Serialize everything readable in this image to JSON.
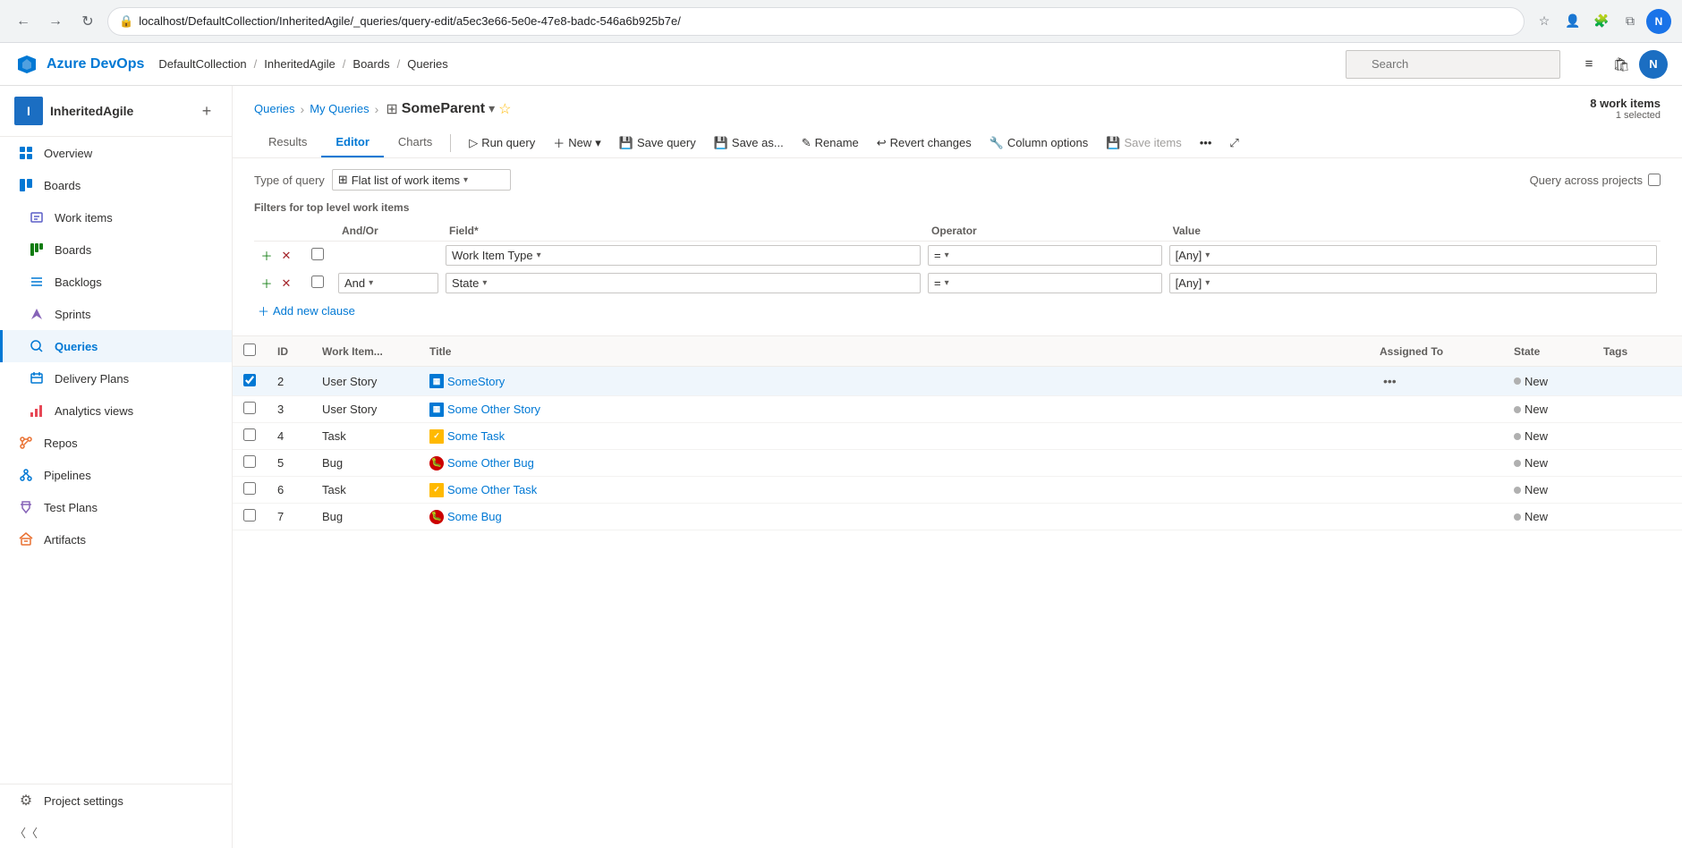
{
  "browser": {
    "address": "localhost/DefaultCollection/InheritedAgile/_queries/query-edit/a5ec3e66-5e0e-47e8-badc-546a6b925b7e/",
    "user_initial": "N"
  },
  "topnav": {
    "logo_text": "Azure DevOps",
    "breadcrumb": [
      {
        "label": "DefaultCollection"
      },
      {
        "label": "InheritedAgile"
      },
      {
        "label": "Boards"
      },
      {
        "label": "Queries"
      }
    ],
    "search_placeholder": "Search"
  },
  "sidebar": {
    "project_initial": "I",
    "project_name": "InheritedAgile",
    "nav_items": [
      {
        "id": "overview",
        "label": "Overview",
        "icon": "⊞"
      },
      {
        "id": "boards-header",
        "label": "Boards",
        "icon": "▦"
      },
      {
        "id": "workitems",
        "label": "Work items",
        "icon": "☰"
      },
      {
        "id": "boards",
        "label": "Boards",
        "icon": "▤"
      },
      {
        "id": "backlogs",
        "label": "Backlogs",
        "icon": "≡"
      },
      {
        "id": "sprints",
        "label": "Sprints",
        "icon": "⚡"
      },
      {
        "id": "queries",
        "label": "Queries",
        "icon": "≔",
        "active": true
      },
      {
        "id": "deliveryplans",
        "label": "Delivery Plans",
        "icon": "📅"
      },
      {
        "id": "analyticsviews",
        "label": "Analytics views",
        "icon": "📊"
      },
      {
        "id": "repos",
        "label": "Repos",
        "icon": "⑂"
      },
      {
        "id": "pipelines",
        "label": "Pipelines",
        "icon": "⧖"
      },
      {
        "id": "testplans",
        "label": "Test Plans",
        "icon": "🔬"
      },
      {
        "id": "artifacts",
        "label": "Artifacts",
        "icon": "📦"
      }
    ],
    "settings_label": "Project settings",
    "collapse_label": "Collapse"
  },
  "page": {
    "breadcrumb": [
      {
        "label": "Queries"
      },
      {
        "label": "My Queries"
      }
    ],
    "title": "SomeParent",
    "work_items_count": "8 work items",
    "selected_count": "1 selected",
    "tabs": [
      {
        "label": "Results",
        "active": false
      },
      {
        "label": "Editor",
        "active": true
      },
      {
        "label": "Charts",
        "active": false
      }
    ],
    "toolbar": {
      "run_query": "Run query",
      "new": "New",
      "save_query": "Save query",
      "save_as": "Save as...",
      "rename": "Rename",
      "revert_changes": "Revert changes",
      "column_options": "Column options",
      "save_items": "Save items"
    },
    "query_type_label": "Type of query",
    "query_type_value": "Flat list of work items",
    "query_across_projects": "Query across projects",
    "filters_label": "Filters for top level work items",
    "filter_columns": {
      "and_or": "And/Or",
      "field": "Field*",
      "operator": "Operator",
      "value": "Value"
    },
    "filter_rows": [
      {
        "and_or": "",
        "field": "Work Item Type",
        "operator": "=",
        "value": "[Any]"
      },
      {
        "and_or": "And",
        "field": "State",
        "operator": "=",
        "value": "[Any]"
      }
    ],
    "add_clause_label": "Add new clause",
    "result_columns": [
      {
        "label": "ID"
      },
      {
        "label": "Work Item..."
      },
      {
        "label": "Title"
      },
      {
        "label": "Assigned To"
      },
      {
        "label": "State"
      },
      {
        "label": "Tags"
      }
    ],
    "result_rows": [
      {
        "id": 2,
        "type": "User Story",
        "type_icon": "story",
        "title": "SomeStory",
        "assigned_to": "",
        "state": "New",
        "tags": "",
        "selected": true
      },
      {
        "id": 3,
        "type": "User Story",
        "type_icon": "story",
        "title": "Some Other Story",
        "assigned_to": "",
        "state": "New",
        "tags": ""
      },
      {
        "id": 4,
        "type": "Task",
        "type_icon": "task",
        "title": "Some Task",
        "assigned_to": "",
        "state": "New",
        "tags": ""
      },
      {
        "id": 5,
        "type": "Bug",
        "type_icon": "bug",
        "title": "Some Other Bug",
        "assigned_to": "",
        "state": "New",
        "tags": ""
      },
      {
        "id": 6,
        "type": "Task",
        "type_icon": "task",
        "title": "Some Other Task",
        "assigned_to": "",
        "state": "New",
        "tags": ""
      },
      {
        "id": 7,
        "type": "Bug",
        "type_icon": "bug",
        "title": "Some Bug",
        "assigned_to": "",
        "state": "New",
        "tags": ""
      }
    ]
  }
}
